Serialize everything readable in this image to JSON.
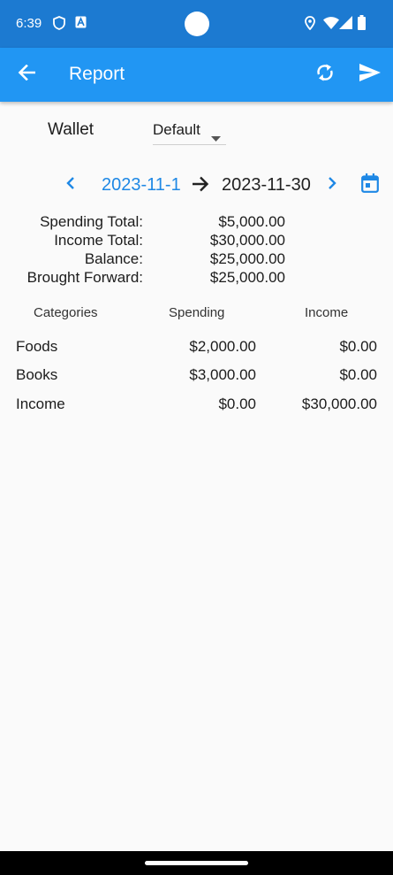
{
  "status": {
    "time": "6:39"
  },
  "appbar": {
    "title": "Report"
  },
  "wallet": {
    "label": "Wallet",
    "selected": "Default"
  },
  "date_range": {
    "start": "2023-11-1",
    "end": "2023-11-30"
  },
  "summary": [
    {
      "label": "Spending Total:",
      "value": "$5,000.00"
    },
    {
      "label": "Income Total:",
      "value": "$30,000.00"
    },
    {
      "label": "Balance:",
      "value": "$25,000.00"
    },
    {
      "label": "Brought Forward:",
      "value": "$25,000.00"
    }
  ],
  "table": {
    "headers": [
      "Categories",
      "Spending",
      "Income"
    ],
    "rows": [
      {
        "category": "Foods",
        "spending": "$2,000.00",
        "income": "$0.00"
      },
      {
        "category": "Books",
        "spending": "$3,000.00",
        "income": "$0.00"
      },
      {
        "category": "Income",
        "spending": "$0.00",
        "income": "$30,000.00"
      }
    ]
  },
  "colors": {
    "statusbar": "#1c7ad1",
    "appbar": "#2196f3",
    "accent": "#1e88e5",
    "background": "#fafafa"
  }
}
